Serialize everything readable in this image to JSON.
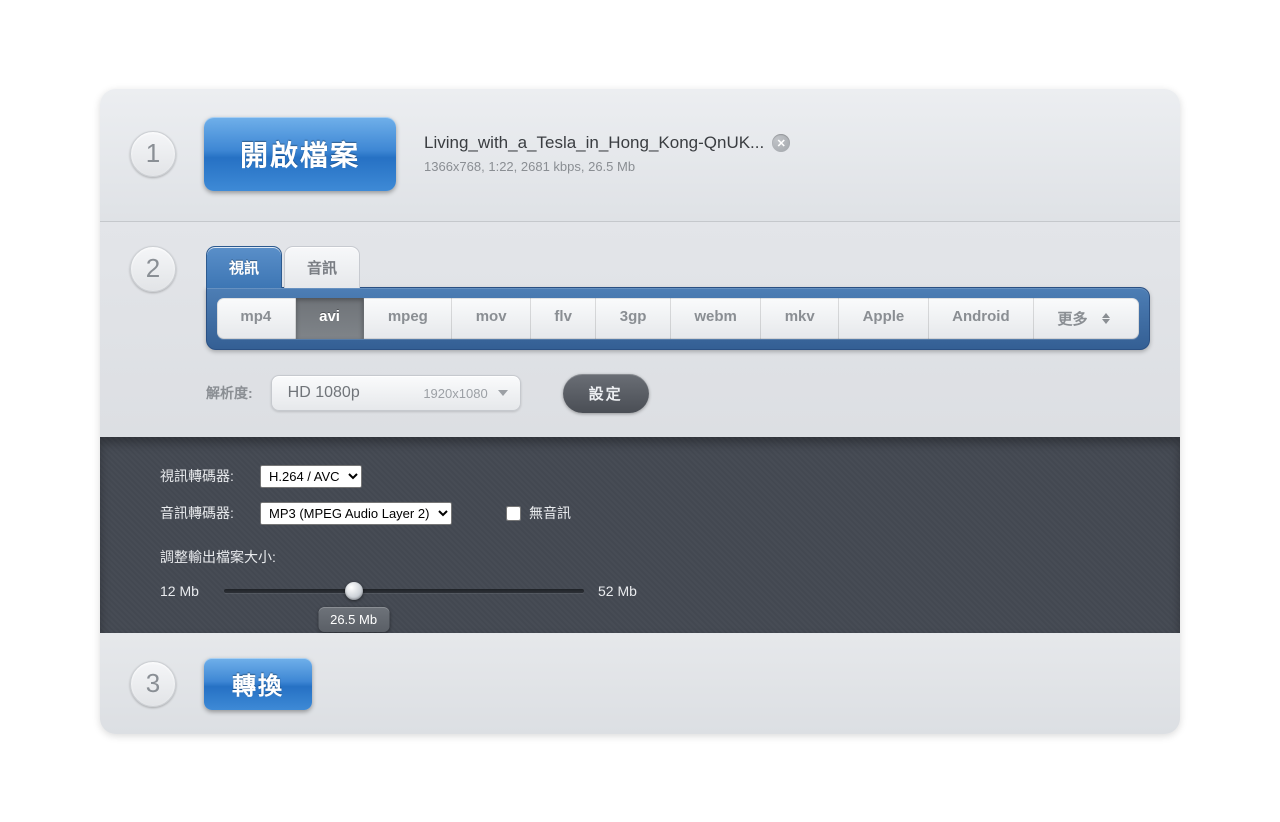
{
  "step1": {
    "badge": "1",
    "open_button_label": "開啟檔案",
    "file_name": "Living_with_a_Tesla_in_Hong_Kong-QnUK...",
    "file_meta": "1366x768, 1:22, 2681 kbps, 26.5 Mb"
  },
  "step2": {
    "badge": "2",
    "tabs": {
      "video": "視訊",
      "audio": "音訊"
    },
    "formats": [
      "mp4",
      "avi",
      "mpeg",
      "mov",
      "flv",
      "3gp",
      "webm",
      "mkv",
      "Apple",
      "Android"
    ],
    "more_label": "更多",
    "active_format": "avi",
    "resolution_label": "解析度:",
    "resolution_value": "HD 1080p",
    "resolution_dims": "1920x1080",
    "settings_button": "設定",
    "advanced": {
      "video_codec_label": "視訊轉碼器:",
      "video_codec_value": "H.264 / AVC",
      "audio_codec_label": "音訊轉碼器:",
      "audio_codec_value": "MP3 (MPEG Audio Layer 2)",
      "no_audio_label": "無音訊",
      "size_title": "調整輸出檔案大小:",
      "size_min": "12 Mb",
      "size_max": "52 Mb",
      "size_current": "26.5 Mb"
    }
  },
  "step3": {
    "badge": "3",
    "convert_button_label": "轉換"
  }
}
